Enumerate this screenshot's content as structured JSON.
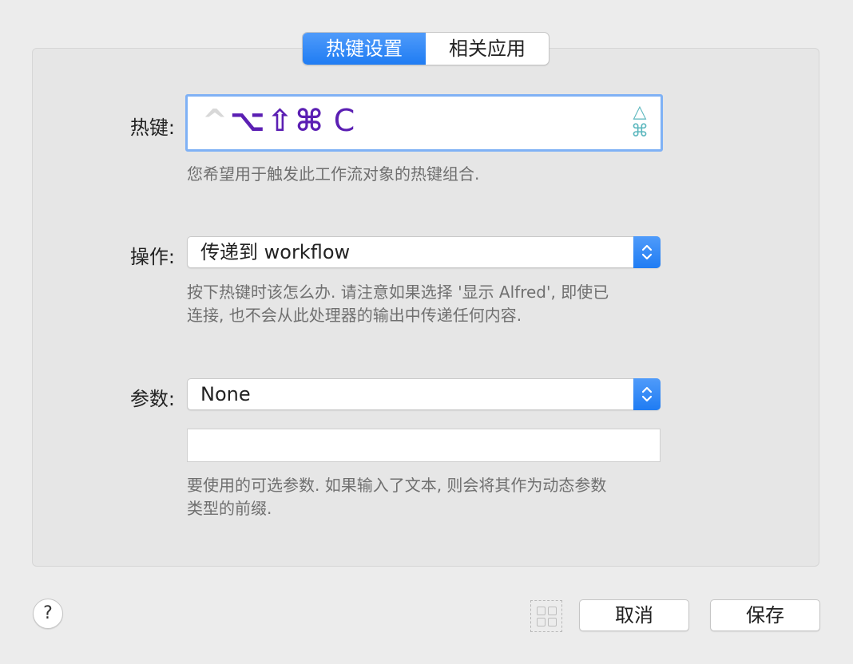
{
  "tabs": [
    {
      "label": "热键设置",
      "active": true
    },
    {
      "label": "相关应用",
      "active": false
    }
  ],
  "hotkey": {
    "label": "热键:",
    "ctrl_symbol": "^",
    "modifier_symbols": "⌥⇧⌘",
    "key": "C",
    "side_icon_top": "△",
    "side_icon_bottom": "⌘",
    "hint": "您希望用于触发此工作流对象的热键组合."
  },
  "action": {
    "label": "操作:",
    "value": "传递到 workflow",
    "hint_line1": "按下热键时该怎么办. 请注意如果选择 '显示 Alfred', 即使已",
    "hint_line2": "连接, 也不会从此处理器的输出中传递任何内容."
  },
  "argument": {
    "label": "参数:",
    "value": "None",
    "text_value": "",
    "hint_line1": "要使用的可选参数. 如果输入了文本, 则会将其作为动态参数",
    "hint_line2": "类型的前缀."
  },
  "footer": {
    "help_label": "?",
    "cancel_label": "取消",
    "save_label": "保存"
  },
  "colors": {
    "accent": "#1f7cf3",
    "modifier_purple": "#5b1fb3",
    "side_teal": "#5bb7be"
  }
}
